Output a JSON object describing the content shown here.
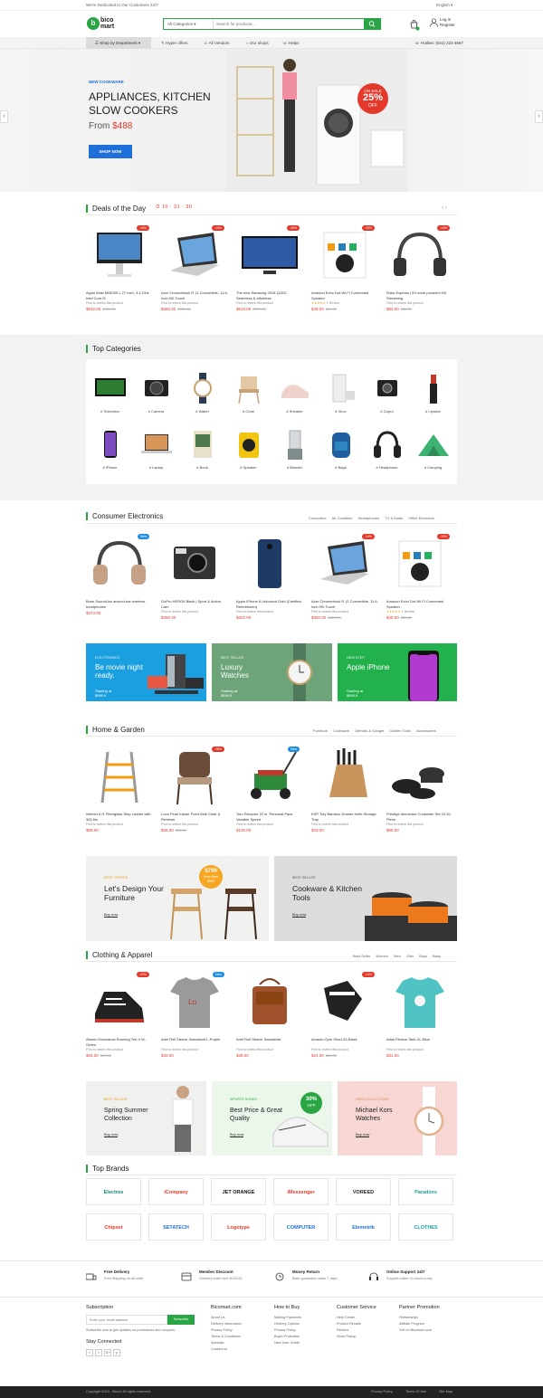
{
  "topbar": {
    "welcome": "We're Dedicated to Our Customers 24/7",
    "language": "English"
  },
  "header": {
    "logo_line1": "bico",
    "logo_line2": "mart",
    "category_select": "All Categories",
    "search_placeholder": "Search for products...",
    "login": "Log in",
    "register": "Register"
  },
  "nav": {
    "department": "Shop by Department",
    "items": [
      "Hyper offers",
      "All Vendors",
      "Our shops",
      "Helps"
    ],
    "hotline": "Hotline: (031) 223 4567"
  },
  "hero": {
    "tag": "NEW COOKWARE",
    "title": "APPLIANCES, KITCHEN SLOW COOKERS",
    "price_prefix": "From",
    "price": "$488",
    "button": "SHOP NOW",
    "sale_top": "ON SALE",
    "sale_pct": "25%",
    "sale_off": "OFF"
  },
  "deals": {
    "title": "Deals of the Day",
    "timer": "10 : 31 : 30",
    "products": [
      {
        "name": "Apple iMac MNE92LL 27 Inch, 3.4 GHz Intel Core i5",
        "review": "First to review this product",
        "price": "$632.00",
        "old": "$720.00",
        "badge": "-15%"
      },
      {
        "name": "Acer Chromebook R 11 Convertible, 11.6-Inch HD Touch",
        "review": "First to review this product",
        "price": "$360.00",
        "old": "$420.00",
        "badge": "-14%"
      },
      {
        "name": "The new Samsung 2018 QLED. Seamless & effortless",
        "review": "First to review this product",
        "price": "$618.00",
        "old": "$727.00",
        "badge": "-16%"
      },
      {
        "name": "Amazon Echo Dot Wi-Fi Connected Speaker",
        "review": "1 Review",
        "price": "$48.00",
        "old": "$59.00",
        "badge": "-15%"
      },
      {
        "name": "Roku Express | 5X more powerful HD Streaming",
        "review": "First to review this product",
        "price": "$84.00",
        "old": "$98.00",
        "badge": "-14%"
      }
    ]
  },
  "top_categories": {
    "title": "Top Categories",
    "items": [
      "# Television",
      "# Camera",
      "# Watch",
      "# Chair",
      "# Sneaker",
      "# Xbox",
      "# Gopro",
      "# Lipstick",
      "# iPhone",
      "# Laptop",
      "# Book",
      "# Speaker",
      "# Blender",
      "# Bags",
      "# Headphone",
      "# Camping"
    ]
  },
  "electronics": {
    "title": "Consumer Electronics",
    "tabs": [
      "Computers",
      "Air Condition",
      "Smartphones",
      "TV & Audio",
      "Office Electronic"
    ],
    "products": [
      {
        "name": "Bose SoundLink around-ear wireless headphones",
        "review": "",
        "price": "$374.00",
        "old": "",
        "badge": "New"
      },
      {
        "name": "GoPro HERO6 Black | Sport & Action Cam",
        "review": "First to review this product",
        "price": "$450.00",
        "old": "",
        "badge": ""
      },
      {
        "name": "Apple iPhone 6 Unlocked Gold (Certified Refurbished)",
        "review": "First to review this product",
        "price": "$322.00",
        "old": "",
        "badge": ""
      },
      {
        "name": "Acer Chromebook R 11 Convertible, 11.6-Inch HD Touch",
        "review": "First to review this product",
        "price": "$360.00",
        "old": "$420.00",
        "badge": "-14%"
      },
      {
        "name": "Amazon Echo Dot Wi-Fi Connected Speaker",
        "review": "1 Review",
        "price": "$48.00",
        "old": "$59.00",
        "badge": "-19%"
      }
    ],
    "banners": [
      {
        "kicker": "ELECTRONICS",
        "title": "Be movie night ready.",
        "sub": "Starting at",
        "price": "$599,9"
      },
      {
        "kicker": "BEST SELLER",
        "title": "Luxury Watches",
        "sub": "Starting at",
        "price": "$599,9"
      },
      {
        "kicker": "NEW STEP",
        "title": "Apple iPhone",
        "sub": "Starting at",
        "price": "$599,9"
      }
    ]
  },
  "home": {
    "title": "Home & Garden",
    "tabs": [
      "Furniture",
      "Cookware",
      "Utensils & Gadget",
      "Garden Tools",
      "Accessories"
    ],
    "products": [
      {
        "name": "Werner 6 ft. Fiberglass Step Ladder with 300 lbs",
        "review": "First to review this product",
        "price": "$68.00",
        "old": "",
        "badge": ""
      },
      {
        "name": "Loon Peak Kaiser Point Side Chair & Reviews",
        "review": "First to review this product",
        "price": "$26.00",
        "old": "$35.00",
        "badge": "-26%"
      },
      {
        "name": "Toro Recycler 22 in. Personal Pace Variable Speed",
        "review": "First to review this product",
        "price": "$130.00",
        "old": "",
        "badge": "New"
      },
      {
        "name": "KSP Tidy Bamboo Drawer Knife Storage Tray",
        "review": "First to review this product",
        "price": "$33.00",
        "old": "",
        "badge": ""
      },
      {
        "name": "Prestige Aluminum Cookware Set Of 10-Piece",
        "review": "First to review this product",
        "price": "$68.00",
        "old": "",
        "badge": ""
      }
    ],
    "banners": [
      {
        "kicker": "BEST OFFERS",
        "title": "Let's Design Your Furniture",
        "button": "Buy now",
        "badge_price": "$799",
        "badge_text": "Price After",
        "badge_price2": "$899"
      },
      {
        "kicker": "BEST SELLER",
        "title": "Cookware & Kitchen Tools",
        "button": "Buy now"
      }
    ]
  },
  "clothing": {
    "title": "Clothing & Apparel",
    "tabs": [
      "Best Seller",
      "Women",
      "Men",
      "Girls",
      "Boys",
      "Baby"
    ],
    "products": [
      {
        "name": "Atomic Endurance Running Tee-V M-Green",
        "review": "First to review this product",
        "price": "$26.00",
        "old": "$29.00",
        "badge": "-22%"
      },
      {
        "name": "Ariel Roll Sleeve Sweatshirt L-Purple",
        "review": "First to review this product",
        "price": "$33.00",
        "old": "",
        "badge": "New"
      },
      {
        "name": "Ariel Roll Sleeve Sweatshirt",
        "review": "First to review this product",
        "price": "$38.00",
        "old": "",
        "badge": ""
      },
      {
        "name": "Arcadio Gym Short-32-Black",
        "review": "First to review this product",
        "price": "$24.00",
        "old": "$28.00",
        "badge": "-14%"
      },
      {
        "name": "Atlas Fitness Tank-XL-Blue",
        "review": "First to review this product",
        "price": "$31.00",
        "old": "",
        "badge": ""
      }
    ],
    "banners": [
      {
        "kicker": "BEST SELLER",
        "title": "Spring Summer Collection",
        "button": "Buy now"
      },
      {
        "kicker": "SPORTS SHOES",
        "title": "Best Price & Great Quality",
        "button": "Buy now",
        "badge_pct": "30%",
        "badge_off": "OFF"
      },
      {
        "kicker": "NEW COLLECTIONS",
        "title": "Michael Kors Watches",
        "button": "Buy now"
      }
    ]
  },
  "brands": {
    "title": "Top Brands",
    "items": [
      "Electros",
      "iCompany",
      "JET ORANGE",
      "iMessenger",
      "VOREED",
      "Paradoxx",
      "Chipset",
      "SETATECH",
      "Logotype",
      "COMPUTER",
      "Elemetrik",
      "CLOTHES"
    ]
  },
  "services": [
    {
      "title": "Free Delivery",
      "sub": "Free Shipping on all order"
    },
    {
      "title": "Member Discount",
      "sub": "Onevery order over $120.00"
    },
    {
      "title": "Money Return",
      "sub": "Back guarantee under 7 days"
    },
    {
      "title": "Online Support 24/7",
      "sub": "Support online 24 hours a day"
    }
  ],
  "footer": {
    "subscription_title": "Subscription",
    "email_placeholder": "Enter your email address",
    "subscribe_btn": "Subscribe",
    "subscribe_note": "Subscribe now to get updates on promotions and coupons.",
    "connected": "Stay Connected",
    "social": [
      "f",
      "t",
      "G+",
      "y"
    ],
    "cols": [
      {
        "title": "Bicomart.com",
        "links": [
          "About Us",
          "Delivery Information",
          "Privacy Policy",
          "Terms & Conditions",
          "Specials",
          "Contact us"
        ]
      },
      {
        "title": "How to Buy",
        "links": [
          "Making Payments",
          "Delivery Options",
          "Privacy Policy",
          "Buyer Protection",
          "New User Guide"
        ]
      },
      {
        "title": "Customer Service",
        "links": [
          "Help Center",
          "Product Recalls",
          "Returns",
          "Store Pickup"
        ]
      },
      {
        "title": "Partner Promotion",
        "links": [
          "Partnerships",
          "Affiliate Program",
          "Sell on Bicomart.com"
        ]
      }
    ],
    "copyright": "Copyright 2018 - Bicod. All rights reserved.",
    "bottom_links": [
      "Privacy Policy",
      "Terms Of Use",
      "Site Map"
    ]
  },
  "colors": {
    "accent": "#2aa544",
    "sale": "#e4392a",
    "blue": "#1e6fd9"
  }
}
